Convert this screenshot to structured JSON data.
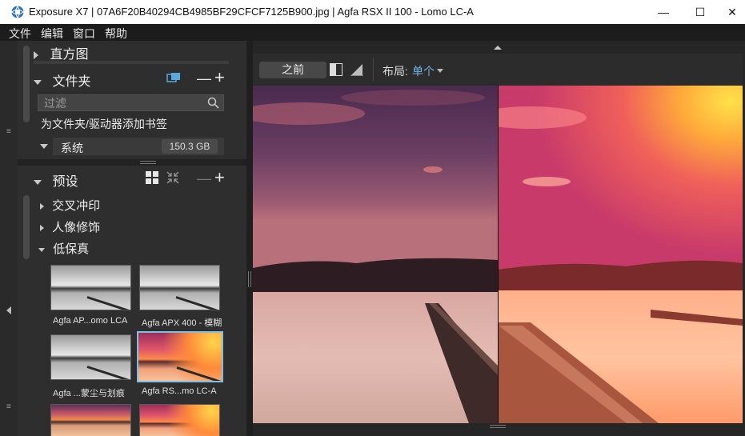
{
  "window": {
    "title": "Exposure X7 | 07A6F20B40294CB4985BF29CFCF7125B900.jpg | Agfa RSX II 100 - Lomo LC-A",
    "minimize_glyph": "—",
    "maximize_glyph": "☐",
    "close_glyph": "✕"
  },
  "menu": {
    "items": [
      "文件",
      "编辑",
      "窗口",
      "帮助"
    ]
  },
  "histogram": {
    "label": "直方图"
  },
  "folders": {
    "label": "文件夹",
    "filter_placeholder": "过滤",
    "bookmark_hint": "为文件夹/驱动器添加书签",
    "drive_label": "系统",
    "drive_size": "150.3 GB",
    "minus_glyph": "—",
    "plus_glyph": "+"
  },
  "presets": {
    "label": "预设",
    "minus_glyph": "—",
    "plus_glyph": "+",
    "categories": [
      {
        "label": "交叉冲印",
        "expanded": false
      },
      {
        "label": "人像修饰",
        "expanded": false
      },
      {
        "label": "低保真",
        "expanded": true
      }
    ],
    "thumbnails": [
      {
        "label": "Agfa AP...omo LCA",
        "style": "gray",
        "selected": false
      },
      {
        "label": "Agfa APX 400 - 模糊",
        "style": "gray",
        "selected": false
      },
      {
        "label": "Agfa ...蒙尘与划痕",
        "style": "gray",
        "selected": false
      },
      {
        "label": "Agfa RS...mo LC-A",
        "style": "color",
        "selected": true
      }
    ]
  },
  "toolbar": {
    "before_label": "之前",
    "layout_label": "布局:",
    "layout_value": "单个"
  },
  "colors": {
    "accent": "#6fb3e4",
    "selection_border": "#7fbfe4",
    "panel_bg": "#2e2e2e"
  },
  "icons": [
    "app-logo-icon",
    "folder-bookmark-icon",
    "search-icon",
    "grid-view-icon",
    "collapse-icon",
    "split-view-icon",
    "triangle-compare-icon"
  ]
}
